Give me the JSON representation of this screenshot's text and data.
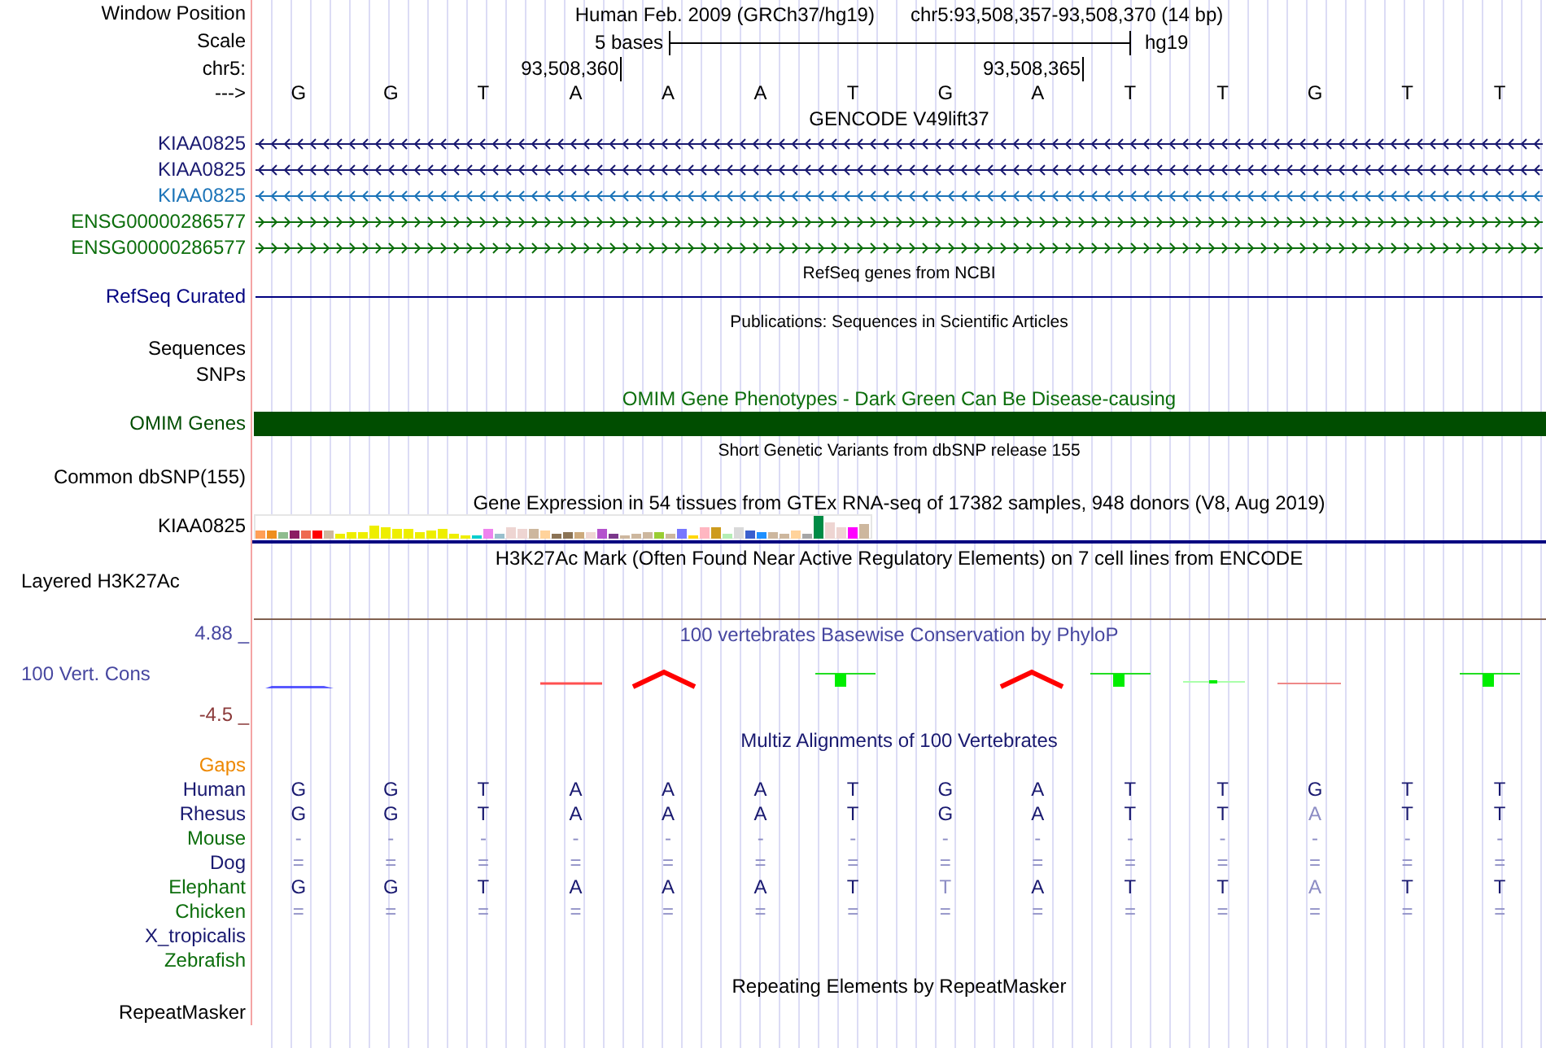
{
  "header": {
    "label": "Window Position",
    "assembly": "Human Feb. 2009 (GRCh37/hg19)",
    "position": "chr5:93,508,357-93,508,370 (14 bp)"
  },
  "scale": {
    "label": "Scale",
    "span": "5 bases",
    "database": "hg19"
  },
  "ruler": {
    "label": "chr5:"
  },
  "sequence": {
    "label": "--->",
    "bases": [
      {
        "base": "G"
      },
      {
        "base": "G"
      },
      {
        "base": "T"
      },
      {
        "base": "A",
        "tick": "93,508,360"
      },
      {
        "base": "A"
      },
      {
        "base": "A"
      },
      {
        "base": "T"
      },
      {
        "base": "G"
      },
      {
        "base": "A",
        "tick": "93,508,365"
      },
      {
        "base": "T"
      },
      {
        "base": "T"
      },
      {
        "base": "G"
      },
      {
        "base": "T"
      },
      {
        "base": "T"
      }
    ]
  },
  "tracks": [
    {
      "kind": "genes",
      "title": "GENCODE V49lift37",
      "items": [
        {
          "label": "KIAA0825",
          "kind": "reverse",
          "color": "#191970"
        },
        {
          "label": "KIAA0825",
          "kind": "reverse",
          "color": "#191970"
        },
        {
          "label": "KIAA0825",
          "kind": "reverse",
          "color": "#1c74b8"
        },
        {
          "label": "ENSG00000286577",
          "kind": "forward",
          "color": "#0c6e0c"
        },
        {
          "label": "ENSG00000286577",
          "kind": "forward",
          "color": "#0c6e0c"
        }
      ]
    },
    {
      "kind": "refseq",
      "title": "RefSeq genes from NCBI",
      "label": "RefSeq Curated",
      "color": "#000080"
    },
    {
      "kind": "empty",
      "title": "Publications: Sequences in Scientific Articles",
      "labels": [
        "Sequences",
        "SNPs"
      ]
    },
    {
      "kind": "bar",
      "title": "OMIM Gene Phenotypes - Dark Green Can Be Disease-causing",
      "label": "OMIM Genes",
      "color": "#004d00"
    },
    {
      "kind": "empty",
      "title": "Short Genetic Variants from dbSNP release 155",
      "labels": [
        "Common dbSNP(155)"
      ]
    },
    {
      "kind": "expression",
      "title": "Gene Expression in 54 tissues from GTEx RNA-seq of 17382 samples, 948 donors (V8, Aug 2019)",
      "label": "KIAA0825"
    },
    {
      "kind": "signal",
      "title": "H3K27Ac Mark (Often Found Near Active Regulatory Elements) on 7 cell lines from ENCODE",
      "label": "Layered H3K27Ac"
    },
    {
      "kind": "conservation",
      "title": "100 vertebrates Basewise Conservation by PhyloP",
      "label": "100 Vert. Cons",
      "ymax": "4.88 _",
      "ymin": "-4.5 _"
    },
    {
      "kind": "alignment",
      "title": "Multiz Alignments of 100 Vertebrates",
      "gaps_label": "Gaps",
      "species": [
        {
          "name": "Human",
          "color": "#191970",
          "bases": [
            {
              "b": "G",
              "faded": false
            },
            {
              "b": "G",
              "faded": false
            },
            {
              "b": "T",
              "faded": false
            },
            {
              "b": "A",
              "faded": false
            },
            {
              "b": "A",
              "faded": false
            },
            {
              "b": "A",
              "faded": false
            },
            {
              "b": "T",
              "faded": false
            },
            {
              "b": "G",
              "faded": false
            },
            {
              "b": "A",
              "faded": false
            },
            {
              "b": "T",
              "faded": false
            },
            {
              "b": "T",
              "faded": false
            },
            {
              "b": "G",
              "faded": false
            },
            {
              "b": "T",
              "faded": false
            },
            {
              "b": "T",
              "faded": false
            }
          ]
        },
        {
          "name": "Rhesus",
          "color": "#191970",
          "bases": [
            {
              "b": "G",
              "faded": false
            },
            {
              "b": "G",
              "faded": false
            },
            {
              "b": "T",
              "faded": false
            },
            {
              "b": "A",
              "faded": false
            },
            {
              "b": "A",
              "faded": false
            },
            {
              "b": "A",
              "faded": false
            },
            {
              "b": "T",
              "faded": false
            },
            {
              "b": "G",
              "faded": false
            },
            {
              "b": "A",
              "faded": false
            },
            {
              "b": "T",
              "faded": false
            },
            {
              "b": "T",
              "faded": false
            },
            {
              "b": "A",
              "faded": true
            },
            {
              "b": "T",
              "faded": false
            },
            {
              "b": "T",
              "faded": false
            }
          ]
        },
        {
          "name": "Mouse",
          "color": "#0c6e0c",
          "bases": [
            {
              "b": "-",
              "faded": true
            },
            {
              "b": "-",
              "faded": true
            },
            {
              "b": "-",
              "faded": true
            },
            {
              "b": "-",
              "faded": true
            },
            {
              "b": "-",
              "faded": true
            },
            {
              "b": "-",
              "faded": true
            },
            {
              "b": "-",
              "faded": true
            },
            {
              "b": "-",
              "faded": true
            },
            {
              "b": "-",
              "faded": true
            },
            {
              "b": "-",
              "faded": true
            },
            {
              "b": "-",
              "faded": true
            },
            {
              "b": "-",
              "faded": true
            },
            {
              "b": "-",
              "faded": true
            },
            {
              "b": "-",
              "faded": true
            }
          ]
        },
        {
          "name": "Dog",
          "color": "#191970",
          "bases": [
            {
              "b": "=",
              "faded": true
            },
            {
              "b": "=",
              "faded": true
            },
            {
              "b": "=",
              "faded": true
            },
            {
              "b": "=",
              "faded": true
            },
            {
              "b": "=",
              "faded": true
            },
            {
              "b": "=",
              "faded": true
            },
            {
              "b": "=",
              "faded": true
            },
            {
              "b": "=",
              "faded": true
            },
            {
              "b": "=",
              "faded": true
            },
            {
              "b": "=",
              "faded": true
            },
            {
              "b": "=",
              "faded": true
            },
            {
              "b": "=",
              "faded": true
            },
            {
              "b": "=",
              "faded": true
            },
            {
              "b": "=",
              "faded": true
            }
          ]
        },
        {
          "name": "Elephant",
          "color": "#0c6e0c",
          "bases": [
            {
              "b": "G",
              "faded": false
            },
            {
              "b": "G",
              "faded": false
            },
            {
              "b": "T",
              "faded": false
            },
            {
              "b": "A",
              "faded": false
            },
            {
              "b": "A",
              "faded": false
            },
            {
              "b": "A",
              "faded": false
            },
            {
              "b": "T",
              "faded": false
            },
            {
              "b": "T",
              "faded": true
            },
            {
              "b": "A",
              "faded": false
            },
            {
              "b": "T",
              "faded": false
            },
            {
              "b": "T",
              "faded": false
            },
            {
              "b": "A",
              "faded": true
            },
            {
              "b": "T",
              "faded": false
            },
            {
              "b": "T",
              "faded": false
            }
          ]
        },
        {
          "name": "Chicken",
          "color": "#0c6e0c",
          "bases": [
            {
              "b": "=",
              "faded": true
            },
            {
              "b": "=",
              "faded": true
            },
            {
              "b": "=",
              "faded": true
            },
            {
              "b": "=",
              "faded": true
            },
            {
              "b": "=",
              "faded": true
            },
            {
              "b": "=",
              "faded": true
            },
            {
              "b": "=",
              "faded": true
            },
            {
              "b": "=",
              "faded": true
            },
            {
              "b": "=",
              "faded": true
            },
            {
              "b": "=",
              "faded": true
            },
            {
              "b": "=",
              "faded": true
            },
            {
              "b": "=",
              "faded": true
            },
            {
              "b": "=",
              "faded": true
            },
            {
              "b": "=",
              "faded": true
            }
          ]
        },
        {
          "name": "X_tropicalis",
          "color": "#191970"
        },
        {
          "name": "Zebrafish",
          "color": "#0c6e0c"
        }
      ]
    },
    {
      "kind": "repeats",
      "title": "Repeating Elements by RepeatMasker",
      "label": "RepeatMasker"
    }
  ]
}
